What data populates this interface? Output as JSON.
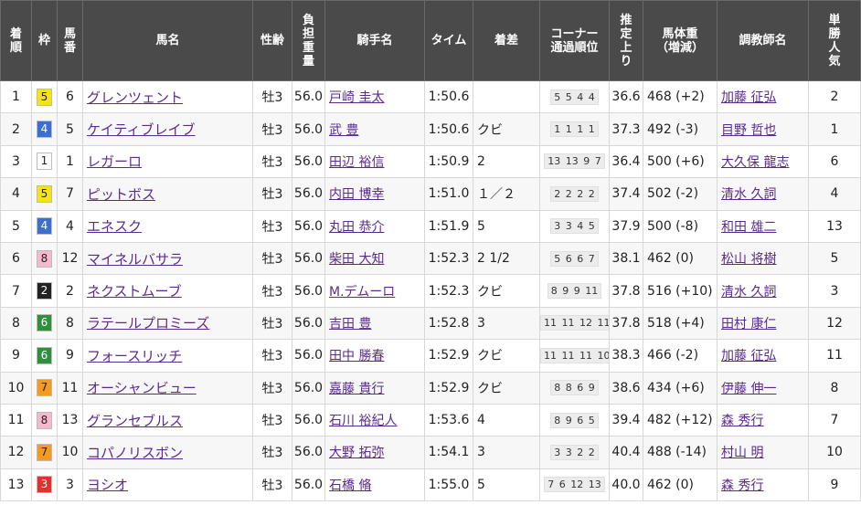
{
  "headers": {
    "finish": "着順",
    "waku": "枠",
    "umaban": "馬番",
    "horse": "馬名",
    "sexage": "性齢",
    "weight": "負担重量",
    "jockey": "騎手名",
    "time": "タイム",
    "margin": "着差",
    "corner_1": "コーナー",
    "corner_2": "通過順位",
    "last3f": "推定上り",
    "bw_1": "馬体重",
    "bw_2": "（増減）",
    "trainer": "調教師名",
    "pop": "単勝人気"
  },
  "waku_colors": {
    "1": {
      "bg": "#ffffff",
      "fg": "#222222"
    },
    "2": {
      "bg": "#222222",
      "fg": "#ffffff"
    },
    "3": {
      "bg": "#e0312c",
      "fg": "#ffffff"
    },
    "4": {
      "bg": "#3b6fd1",
      "fg": "#ffffff"
    },
    "5": {
      "bg": "#f5e21b",
      "fg": "#222222"
    },
    "6": {
      "bg": "#2f8f3a",
      "fg": "#ffffff"
    },
    "7": {
      "bg": "#f49a1e",
      "fg": "#222222"
    },
    "8": {
      "bg": "#f7b7cc",
      "fg": "#222222"
    }
  },
  "rows": [
    {
      "finish": "1",
      "waku": "5",
      "umaban": "6",
      "horse": "グレンツェント",
      "sexage": "牡3",
      "weight": "56.0",
      "jockey": "戸崎 圭太",
      "time": "1:50.6",
      "margin": "",
      "corner": "5 5 4 4",
      "last3f": "36.6",
      "bodyweight": "468 (+2)",
      "trainer": "加藤 征弘",
      "pop": "2"
    },
    {
      "finish": "2",
      "waku": "4",
      "umaban": "5",
      "horse": "ケイティブレイブ",
      "sexage": "牡3",
      "weight": "56.0",
      "jockey": "武 豊",
      "time": "1:50.6",
      "margin": "クビ",
      "corner": "1 1 1 1",
      "last3f": "37.3",
      "bodyweight": "492 (-3)",
      "trainer": "目野 哲也",
      "pop": "1"
    },
    {
      "finish": "3",
      "waku": "1",
      "umaban": "1",
      "horse": "レガーロ",
      "sexage": "牡3",
      "weight": "56.0",
      "jockey": "田辺 裕信",
      "time": "1:50.9",
      "margin": "2",
      "corner": "13 13 9 7",
      "last3f": "36.4",
      "bodyweight": "500 (+6)",
      "trainer": "大久保 龍志",
      "pop": "6"
    },
    {
      "finish": "4",
      "waku": "5",
      "umaban": "7",
      "horse": "ピットボス",
      "sexage": "牡3",
      "weight": "56.0",
      "jockey": "内田 博幸",
      "time": "1:51.0",
      "margin": "１／２",
      "corner": "2 2 2 2",
      "last3f": "37.4",
      "bodyweight": "502 (-2)",
      "trainer": "清水 久詞",
      "pop": "4"
    },
    {
      "finish": "5",
      "waku": "4",
      "umaban": "4",
      "horse": "エネスク",
      "sexage": "牡3",
      "weight": "56.0",
      "jockey": "丸田 恭介",
      "time": "1:51.9",
      "margin": "5",
      "corner": "3 3 4 5",
      "last3f": "37.9",
      "bodyweight": "500 (-8)",
      "trainer": "和田 雄二",
      "pop": "13"
    },
    {
      "finish": "6",
      "waku": "8",
      "umaban": "12",
      "horse": "マイネルバサラ",
      "sexage": "牡3",
      "weight": "56.0",
      "jockey": "柴田 大知",
      "time": "1:52.3",
      "margin": "2 1/2",
      "corner": "5 6 6 7",
      "last3f": "38.1",
      "bodyweight": "462 (0)",
      "trainer": "松山 将樹",
      "pop": "5"
    },
    {
      "finish": "7",
      "waku": "2",
      "umaban": "2",
      "horse": "ネクストムーブ",
      "sexage": "牡3",
      "weight": "56.0",
      "jockey": "M.デムーロ",
      "time": "1:52.3",
      "margin": "クビ",
      "corner": "8 9 9 11",
      "last3f": "37.8",
      "bodyweight": "516 (+10)",
      "trainer": "清水 久詞",
      "pop": "3"
    },
    {
      "finish": "8",
      "waku": "6",
      "umaban": "8",
      "horse": "ラテールプロミーズ",
      "sexage": "牡3",
      "weight": "56.0",
      "jockey": "吉田 豊",
      "time": "1:52.8",
      "margin": "3",
      "corner": "11 11 12 11",
      "last3f": "37.8",
      "bodyweight": "518 (+4)",
      "trainer": "田村 康仁",
      "pop": "12"
    },
    {
      "finish": "9",
      "waku": "6",
      "umaban": "9",
      "horse": "フォースリッチ",
      "sexage": "牡3",
      "weight": "56.0",
      "jockey": "田中 勝春",
      "time": "1:52.9",
      "margin": "クビ",
      "corner": "11 11 11 10",
      "last3f": "38.3",
      "bodyweight": "466 (-2)",
      "trainer": "加藤 征弘",
      "pop": "11"
    },
    {
      "finish": "10",
      "waku": "7",
      "umaban": "11",
      "horse": "オーシャンビュー",
      "sexage": "牡3",
      "weight": "56.0",
      "jockey": "嘉藤 貴行",
      "time": "1:52.9",
      "margin": "クビ",
      "corner": "8 8 6 9",
      "last3f": "38.6",
      "bodyweight": "434 (+6)",
      "trainer": "伊藤 伸一",
      "pop": "8"
    },
    {
      "finish": "11",
      "waku": "8",
      "umaban": "13",
      "horse": "グランセブルス",
      "sexage": "牡3",
      "weight": "56.0",
      "jockey": "石川 裕紀人",
      "time": "1:53.6",
      "margin": "4",
      "corner": "8 9 6 5",
      "last3f": "39.4",
      "bodyweight": "482 (+12)",
      "trainer": "森 秀行",
      "pop": "7"
    },
    {
      "finish": "12",
      "waku": "7",
      "umaban": "10",
      "horse": "コパノリスボン",
      "sexage": "牡3",
      "weight": "56.0",
      "jockey": "大野 拓弥",
      "time": "1:54.1",
      "margin": "3",
      "corner": "3 3 2 2",
      "last3f": "40.4",
      "bodyweight": "488 (-14)",
      "trainer": "村山 明",
      "pop": "10"
    },
    {
      "finish": "13",
      "waku": "3",
      "umaban": "3",
      "horse": "ヨシオ",
      "sexage": "牡3",
      "weight": "56.0",
      "jockey": "石橋 脩",
      "time": "1:55.0",
      "margin": "5",
      "corner": "7 6 12 13",
      "last3f": "40.0",
      "bodyweight": "462 (0)",
      "trainer": "森 秀行",
      "pop": "9"
    }
  ]
}
